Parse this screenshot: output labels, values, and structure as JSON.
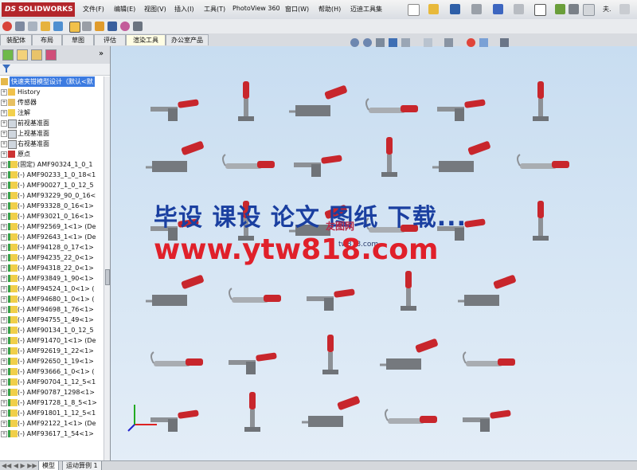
{
  "app": {
    "logo_text": "SOLIDWORKS",
    "logo_prefix": "DS"
  },
  "menu": [
    "文件(F)",
    "编辑(E)",
    "视图(V)",
    "插入(I)",
    "工具(T)",
    "PhotoView 360",
    "窗口(W)",
    "帮助(H)",
    "迈迪工具集"
  ],
  "menu_overflow": "夫.",
  "command_tabs": [
    "装配体",
    "布局",
    "草图",
    "评估",
    "渲染工具",
    "办公室产品"
  ],
  "active_command_tab": "渲染工具",
  "tree": {
    "root": "快速夹钳模型设计（默认<默",
    "items": [
      {
        "label": "History",
        "icon": "history-icon"
      },
      {
        "label": "传感器",
        "icon": "sensor-icon"
      },
      {
        "label": "注解",
        "icon": "annotation-icon"
      },
      {
        "label": "前视基准面",
        "icon": "plane-icon"
      },
      {
        "label": "上视基准面",
        "icon": "plane-icon"
      },
      {
        "label": "右视基准面",
        "icon": "plane-icon"
      },
      {
        "label": "原点",
        "icon": "origin-icon"
      },
      {
        "label": "(固定) AMF90324_1_0_1",
        "icon": "part-icon"
      },
      {
        "label": "(-) AMF90233_1_0_18<1",
        "icon": "part-icon"
      },
      {
        "label": "(-) AMF90027_1_0_12_5",
        "icon": "part-icon"
      },
      {
        "label": "(-) AMF93229_90_0_16<",
        "icon": "part-icon"
      },
      {
        "label": "(-) AMF93328_0_16<1>",
        "icon": "part-icon"
      },
      {
        "label": "(-) AMF93021_0_16<1>",
        "icon": "part-icon"
      },
      {
        "label": "(-) AMF92569_1<1> (De",
        "icon": "part-icon"
      },
      {
        "label": "(-) AMF92643_1<1> (De",
        "icon": "part-icon"
      },
      {
        "label": "(-) AMF94128_0_17<1>",
        "icon": "part-icon"
      },
      {
        "label": "(-) AMF94235_22_0<1>",
        "icon": "part-icon"
      },
      {
        "label": "(-) AMF94318_22_0<1>",
        "icon": "part-icon"
      },
      {
        "label": "(-) AMF93849_1_90<1>",
        "icon": "part-icon"
      },
      {
        "label": "(-) AMF94524_1_0<1> (",
        "icon": "part-icon"
      },
      {
        "label": "(-) AMF94680_1_0<1> (",
        "icon": "part-icon"
      },
      {
        "label": "(-) AMF94698_1_76<1>",
        "icon": "part-icon"
      },
      {
        "label": "(-) AMF94755_1_49<1>",
        "icon": "part-icon"
      },
      {
        "label": "(-) AMF90134_1_0_12_5",
        "icon": "part-icon"
      },
      {
        "label": "(-) AMF91470_1<1> (De",
        "icon": "part-icon"
      },
      {
        "label": "(-) AMF92619_1_22<1>",
        "icon": "part-icon"
      },
      {
        "label": "(-) AMF92650_1_19<1>",
        "icon": "part-icon"
      },
      {
        "label": "(-) AMF93666_1_0<1> (",
        "icon": "part-icon"
      },
      {
        "label": "(-) AMF90704_1_12_5<1",
        "icon": "part-icon"
      },
      {
        "label": "(-) AMF90787_1298<1>",
        "icon": "part-icon"
      },
      {
        "label": "(-) AMF91728_1_8_5<1>",
        "icon": "part-icon"
      },
      {
        "label": "(-) AMF91801_1_12_5<1",
        "icon": "part-icon"
      },
      {
        "label": "(-) AMF92122_1<1> (De",
        "icon": "part-icon"
      },
      {
        "label": "(-) AMF93617_1_54<1>",
        "icon": "part-icon"
      }
    ]
  },
  "watermark": {
    "line1": "毕设 课设 论文 图纸 下载...",
    "line2": "www.ytw818.com",
    "small1": "友图网",
    "small2": "tw818.com"
  },
  "bottom_tabs": [
    "模型",
    "运动算例 1"
  ],
  "active_bottom_tab": "模型",
  "colors": {
    "handle_red": "#c8262c",
    "metal": "#8d9196",
    "viewport_bg": "#cfe1f3",
    "tree_selection": "#3c7be1",
    "logo_bg": "#b3262b"
  },
  "clamp_grid_count": 32
}
